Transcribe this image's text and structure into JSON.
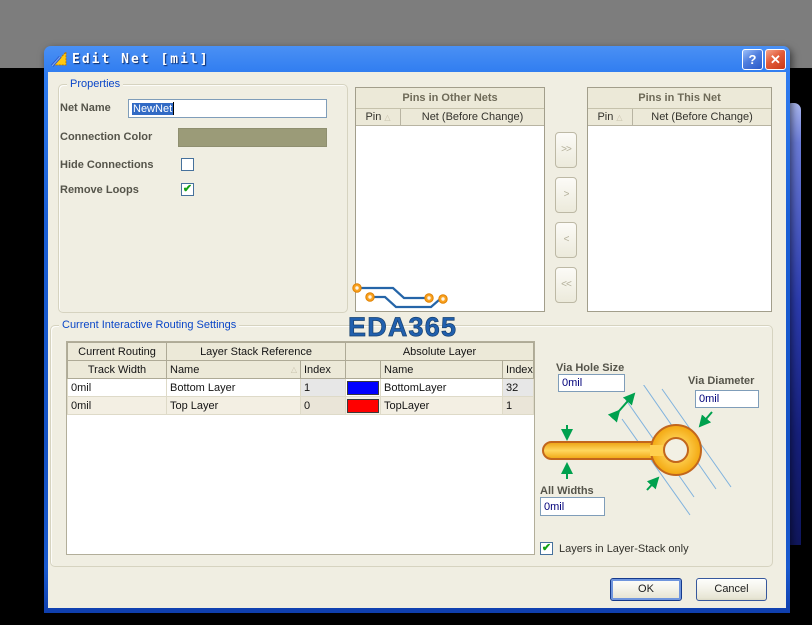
{
  "window": {
    "title": "Edit Net [mil]",
    "help": "?",
    "close": "✕"
  },
  "properties": {
    "group_label": "Properties",
    "net_name": {
      "label": "Net Name",
      "value": "NewNet"
    },
    "connection_color": {
      "label": "Connection Color",
      "color": "#9b9b78"
    },
    "hide_connections": {
      "label": "Hide Connections",
      "checked": false,
      "glyph": ""
    },
    "remove_loops": {
      "label": "Remove Loops",
      "checked": true,
      "glyph": "✔"
    }
  },
  "pins_other_nets": {
    "title": "Pins in Other Nets",
    "columns": {
      "pin": "Pin",
      "net": "Net (Before Change)"
    },
    "rows": []
  },
  "pins_this_net": {
    "title": "Pins in This Net",
    "columns": {
      "pin": "Pin",
      "net": "Net (Before Change)"
    },
    "rows": []
  },
  "transfer_buttons": {
    "move_all_right": ">>",
    "move_right": ">",
    "move_left": "<",
    "move_all_left": "<<"
  },
  "routing_settings": {
    "group_label": "Current Interactive Routing Settings",
    "table": {
      "group_headers": [
        "Current Routing",
        "Layer Stack Reference",
        "Absolute Layer"
      ],
      "sub_headers": [
        "Track Width",
        "Name",
        "Index",
        "Name",
        "Index"
      ],
      "rows": [
        {
          "track_width": "0mil",
          "ref_name": "Bottom Layer",
          "ref_index": "1",
          "layer_color": "#0000ff",
          "abs_name": "BottomLayer",
          "abs_index": "32"
        },
        {
          "track_width": "0mil",
          "ref_name": "Top Layer",
          "ref_index": "0",
          "layer_color": "#ff0000",
          "abs_name": "TopLayer",
          "abs_index": "1"
        }
      ]
    },
    "via_hole_size": {
      "label": "Via Hole Size",
      "value": "0mil"
    },
    "via_diameter": {
      "label": "Via Diameter",
      "value": "0mil"
    },
    "all_widths": {
      "label": "All Widths",
      "value": "0mil"
    },
    "layers_in_stack": {
      "label": "Layers in Layer-Stack only",
      "checked": true,
      "glyph": "✔"
    }
  },
  "footer": {
    "ok": "OK",
    "cancel": "Cancel"
  },
  "watermark": {
    "text": "EDA365"
  },
  "icons": {
    "sort": "△"
  }
}
